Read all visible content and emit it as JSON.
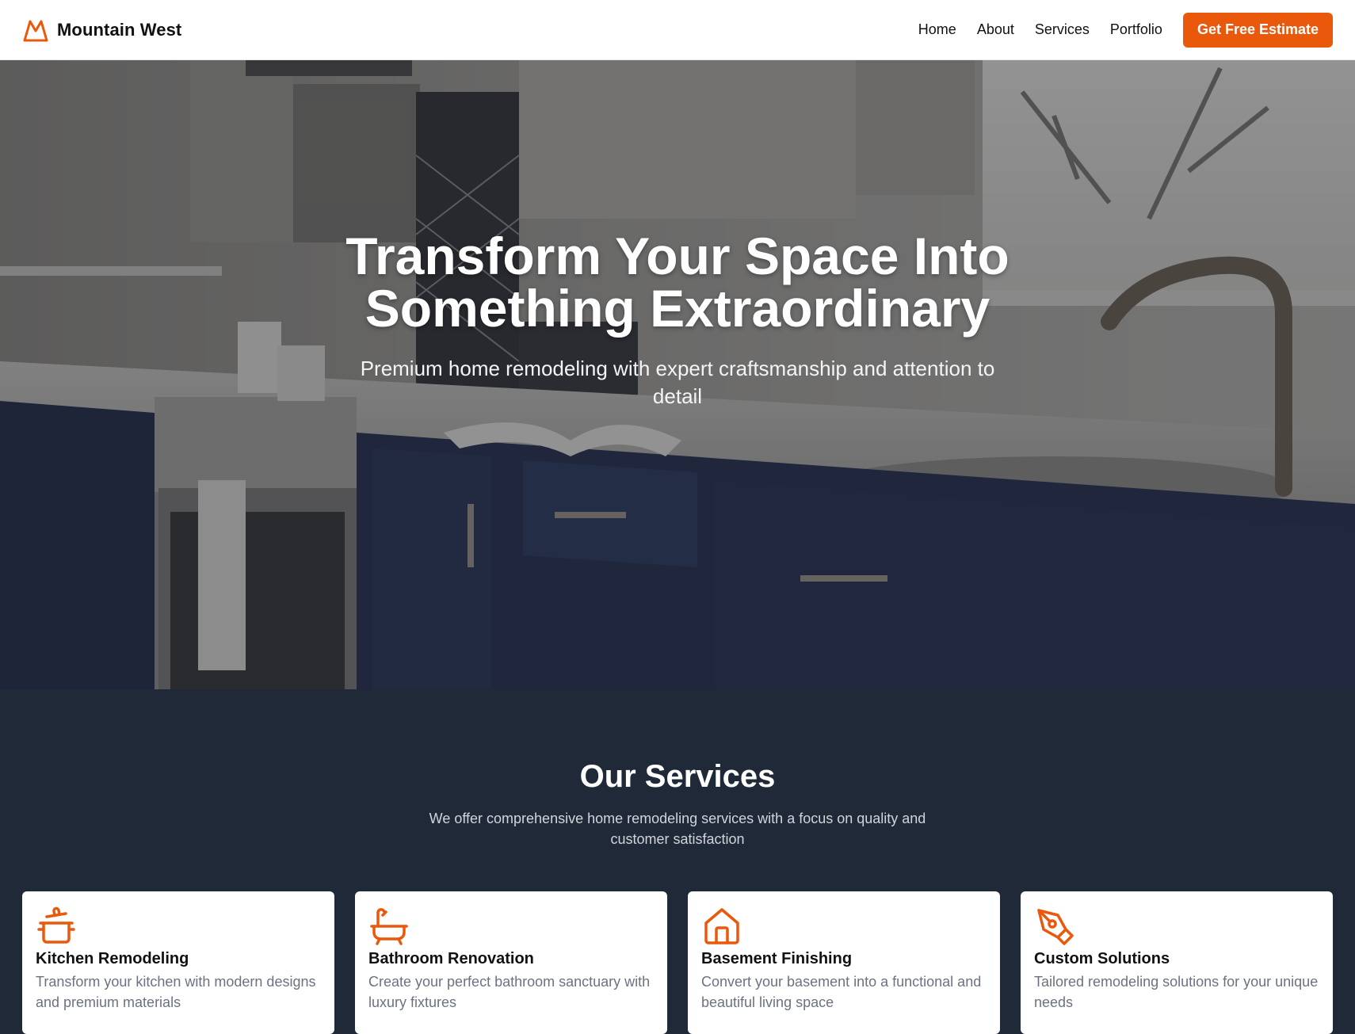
{
  "brand": {
    "name": "Mountain West",
    "logo_icon": "mountain-icon",
    "accent_color": "#ea580c"
  },
  "nav": {
    "items": [
      {
        "label": "Home"
      },
      {
        "label": "About"
      },
      {
        "label": "Services"
      },
      {
        "label": "Portfolio"
      }
    ],
    "cta_label": "Get Free Estimate"
  },
  "hero": {
    "title": "Transform Your Space Into Something Extraordinary",
    "subtitle": "Premium home remodeling with expert craftsmanship and attention to detail",
    "background": "kitchen-photo"
  },
  "services": {
    "title": "Our Services",
    "subtitle": "We offer comprehensive home remodeling services with a focus on quality and customer satisfaction",
    "items": [
      {
        "icon": "cooking-pot-icon",
        "title": "Kitchen Remodeling",
        "description": "Transform your kitchen with modern designs and premium materials"
      },
      {
        "icon": "bathtub-icon",
        "title": "Bathroom Renovation",
        "description": "Create your perfect bathroom sanctuary with luxury fixtures"
      },
      {
        "icon": "house-icon",
        "title": "Basement Finishing",
        "description": "Convert your basement into a functional and beautiful living space"
      },
      {
        "icon": "pen-tool-icon",
        "title": "Custom Solutions",
        "description": "Tailored remodeling solutions for your unique needs"
      }
    ]
  }
}
